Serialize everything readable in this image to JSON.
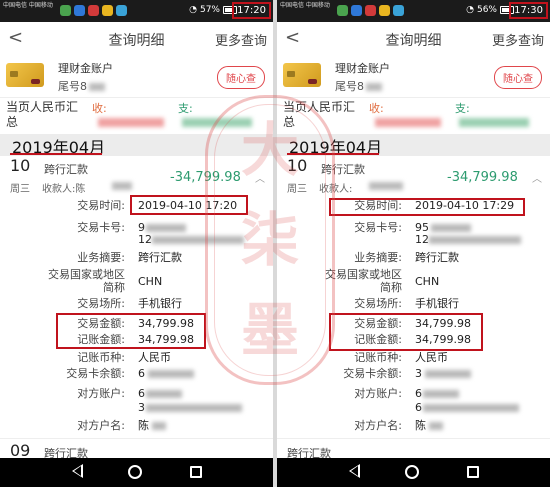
{
  "screens": [
    {
      "status_bar": {
        "carrier": "中国电信 中国移动",
        "battery": "57%",
        "time": "17:20"
      },
      "title_bar": {
        "title": "查询明细",
        "more": "更多查询"
      },
      "account": {
        "name": "理财金账户",
        "tail": "尾号8",
        "quick_query": "随心查"
      },
      "summary": {
        "label": "当页人民币汇总",
        "income_label": "收:",
        "expense_label": "支:"
      },
      "month": "2019年04月",
      "transaction": {
        "day": "10",
        "type": "跨行汇款",
        "weekday": "周三",
        "payee_label": "收款人:陈",
        "amount": "-34,799.98",
        "details": {
          "time_label": "交易时间:",
          "time_value": "2019-04-10 17:20",
          "card_label": "交易卡号:",
          "card_value1": "9",
          "card_value2": "12",
          "summary_label": "业务摘要:",
          "summary_value": "跨行汇款",
          "region_label": "交易国家或地区简称",
          "region_value": "CHN",
          "venue_label": "交易场所:",
          "venue_value": "手机银行",
          "amount_label": "交易金额:",
          "amount_value": "34,799.98",
          "booked_label": "记账金额:",
          "booked_value": "34,799.98",
          "currency_label": "记账币种:",
          "currency_value": "人民币",
          "balance_label": "交易卡余额:",
          "balance_value": "6",
          "counter_acct_label": "对方账户:",
          "counter_acct_value1": "6",
          "counter_acct_value2": "3",
          "counter_name_label": "对方户名:",
          "counter_name_value": "陈"
        }
      },
      "next": {
        "day": "09",
        "type": "跨行汇款"
      }
    },
    {
      "status_bar": {
        "carrier": "中国电信 中国移动",
        "battery": "56%",
        "time": "17:30"
      },
      "title_bar": {
        "title": "查询明细",
        "more": "更多查询"
      },
      "account": {
        "name": "理财金账户",
        "tail": "尾号8",
        "quick_query": "随心查"
      },
      "summary": {
        "label": "当页人民币汇总",
        "income_label": "收:",
        "expense_label": "支:"
      },
      "month": "2019年04月",
      "transaction": {
        "day": "10",
        "type": "跨行汇款",
        "weekday": "周三",
        "payee_label": "收款人:",
        "amount": "-34,799.98",
        "details": {
          "time_label": "交易时间:",
          "time_value": "2019-04-10 17:29",
          "card_label": "交易卡号:",
          "card_value1": "95",
          "card_value2": "12",
          "summary_label": "业务摘要:",
          "summary_value": "跨行汇款",
          "region_label": "交易国家或地区简称",
          "region_value": "CHN",
          "venue_label": "交易场所:",
          "venue_value": "手机银行",
          "amount_label": "交易金额:",
          "amount_value": "34,799.98",
          "booked_label": "记账金额:",
          "booked_value": "34,799.98",
          "currency_label": "记账币种:",
          "currency_value": "人民币",
          "balance_label": "交易卡余额:",
          "balance_value": "3",
          "counter_acct_label": "对方账户:",
          "counter_acct_value1": "6",
          "counter_acct_value2": "6",
          "counter_name_label": "对方户名:",
          "counter_name_value": "陈"
        }
      },
      "next": {
        "day": "",
        "type": "跨行汇款"
      }
    }
  ],
  "seal": {
    "chars": [
      "大",
      "柒",
      "墨"
    ]
  },
  "colors": {
    "accent_red": "#c0131d",
    "expense_green": "#2d9b6f",
    "income_orange": "#e06c3f"
  }
}
